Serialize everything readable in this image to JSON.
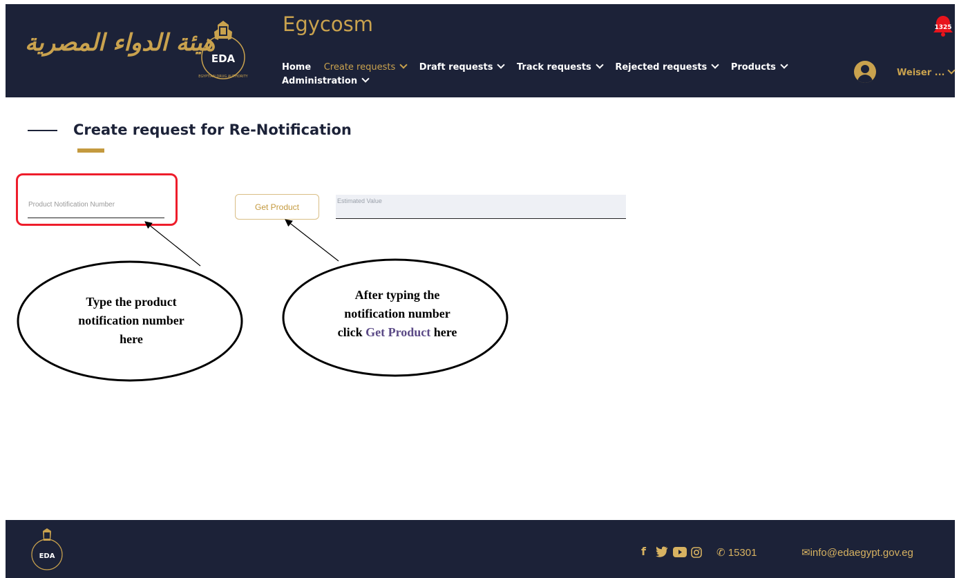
{
  "header": {
    "arabic_logo_text": "هيئة الدواء المصرية",
    "emblem_text": "EDA",
    "emblem_arc_text": "EGYPTIAN DRUG AUTHORITY",
    "app_title": "Egycosm",
    "notification_count": "1325",
    "nav": [
      {
        "label": "Home"
      },
      {
        "label": "Create requests"
      },
      {
        "label": "Draft requests"
      },
      {
        "label": "Track requests"
      },
      {
        "label": "Rejected requests"
      },
      {
        "label": "Products"
      },
      {
        "label": "Administration"
      }
    ],
    "user_name": "Weiser ...",
    "colors": {
      "navy": "#1c2238",
      "gold": "#c9a24e"
    }
  },
  "page": {
    "title": "Create request for Re-Notification"
  },
  "form": {
    "product_notification_placeholder": "Product Notification Number",
    "get_product_label": "Get Product",
    "estimated_value_label": "Estimated Value"
  },
  "callouts": {
    "left": {
      "line1": "Type the product",
      "line2": "notification number",
      "line3": "here"
    },
    "right": {
      "line1": "After typing the",
      "line2": "notification number",
      "line3_prefix": "click ",
      "line3_highlight": "Get Product",
      "line3_suffix": " here"
    }
  },
  "footer": {
    "emblem_text": "EDA",
    "social_icons": [
      "facebook-icon",
      "twitter-icon",
      "youtube-icon",
      "instagram-icon"
    ],
    "phone": "15301",
    "email": "info@edaegypt.gov.eg"
  }
}
